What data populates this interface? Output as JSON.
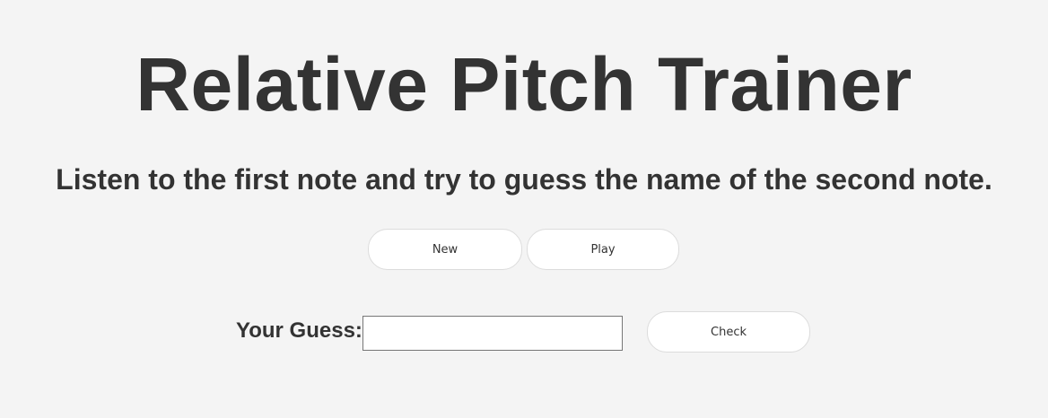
{
  "header": {
    "title": "Relative Pitch Trainer",
    "instructions": "Listen to the first note and try to guess the name of the second note."
  },
  "controls": {
    "new_label": "New",
    "play_label": "Play"
  },
  "guess": {
    "label": "Your Guess:",
    "value": "",
    "placeholder": "",
    "check_label": "Check"
  },
  "colors": {
    "background": "#f4f4f4",
    "text": "#333333",
    "button_bg": "#ffffff"
  }
}
